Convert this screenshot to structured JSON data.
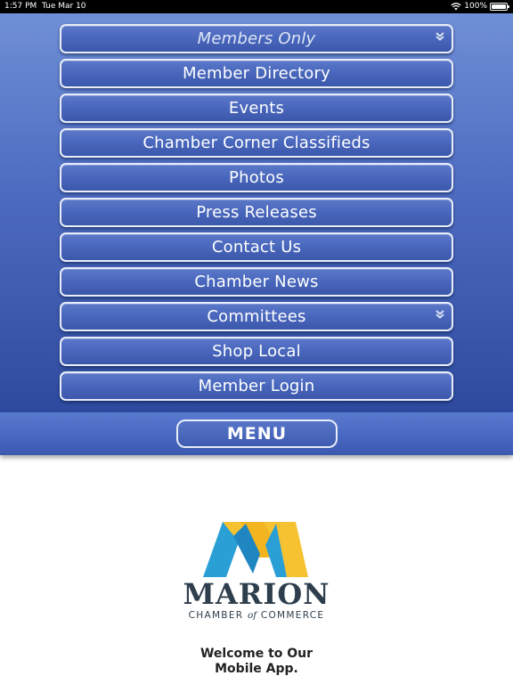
{
  "status_bar": {
    "time": "1:57 PM",
    "date": "Tue Mar 10",
    "battery": "100%"
  },
  "menu": {
    "items": [
      {
        "label": "Members Only",
        "expandable": true,
        "header": true
      },
      {
        "label": "Member Directory"
      },
      {
        "label": "Events"
      },
      {
        "label": "Chamber Corner Classifieds"
      },
      {
        "label": "Photos"
      },
      {
        "label": "Press Releases"
      },
      {
        "label": "Contact Us"
      },
      {
        "label": "Chamber News"
      },
      {
        "label": "Committees",
        "expandable": true
      },
      {
        "label": "Shop Local"
      },
      {
        "label": "Member Login"
      }
    ],
    "toggle_label": "MENU"
  },
  "logo": {
    "name": "MARION",
    "sub_left": "CHAMBER ",
    "sub_of": "of",
    "sub_right": " COMMERCE",
    "colors": {
      "blue": "#2a9fd6",
      "yellow": "#f6c232"
    }
  },
  "welcome": {
    "line1": "Welcome to Our",
    "line2": "Mobile App."
  },
  "colors": {
    "menu_gradient_top": "#6f8fd6",
    "menu_gradient_bottom": "#2e4a9e",
    "button_border": "#e8edf8"
  }
}
